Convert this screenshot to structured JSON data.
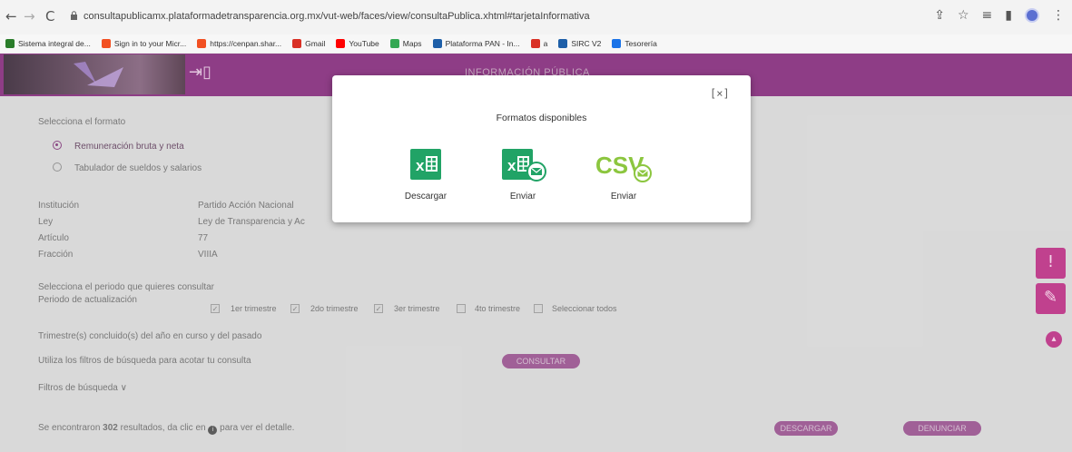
{
  "browser": {
    "url": "consultapublicamx.plataformadetransparencia.org.mx/vut-web/faces/view/consultaPublica.xhtml#tarjetaInformativa",
    "bookmarks": [
      {
        "label": "Sistema integral de...",
        "color": "#2a7d2a"
      },
      {
        "label": "Sign in to your Micr...",
        "color": "#f25022"
      },
      {
        "label": "https://cenpan.shar...",
        "color": "#f25022"
      },
      {
        "label": "Gmail",
        "color": "#d93025"
      },
      {
        "label": "YouTube",
        "color": "#ff0000"
      },
      {
        "label": "Maps",
        "color": "#34a853"
      },
      {
        "label": "Plataforma PAN - In...",
        "color": "#1e5fa8"
      },
      {
        "label": "a",
        "color": "#d93025"
      },
      {
        "label": "SIRC V2",
        "color": "#1e5fa8"
      },
      {
        "label": "Tesorería",
        "color": "#1a73e8"
      }
    ]
  },
  "header": {
    "title": "INFORMACIÓN PÚBLICA"
  },
  "content": {
    "select_format_label": "Selecciona el formato",
    "radio_options": [
      "Remuneración bruta y neta",
      "Tabulador de sueldos y salarios"
    ],
    "fields": {
      "institucion_label": "Institución",
      "institucion_value": "Partido Acción Nacional",
      "ley_label": "Ley",
      "ley_value": "Ley de Transparencia y Ac",
      "articulo_label": "Artículo",
      "articulo_value": "77",
      "fraccion_label": "Fracción",
      "fraccion_value": "VIIIA"
    },
    "period_prompt": "Selecciona el periodo que quieres consultar",
    "period_label": "Periodo de actualización",
    "quarters": [
      "1er trimestre",
      "2do trimestre",
      "3er trimestre",
      "4to trimestre",
      "Seleccionar todos"
    ],
    "quarters_note": "Trimestre(s) concluido(s) del año en curso y del pasado",
    "filters_hint": "Utiliza los filtros de búsqueda para acotar tu consulta",
    "consult_button": "CONSULTAR",
    "filters_toggle": "Filtros de búsqueda",
    "results_prefix": "Se encontraron",
    "results_count": "302",
    "results_suffix_1": "resultados, da clic en",
    "results_suffix_2": "para ver el detalle.",
    "download_button": "DESCARGAR",
    "report_button": "DENUNCIAR"
  },
  "modal": {
    "close_label": "[×]",
    "title": "Formatos disponibles",
    "formats": [
      {
        "label": "Descargar",
        "icon": "excel-icon"
      },
      {
        "label": "Enviar",
        "icon": "excel-email-icon"
      },
      {
        "label": "Enviar",
        "icon": "csv-email-icon",
        "csv_text": "CSV"
      }
    ]
  },
  "colors": {
    "header": "#8e3d86",
    "excel_green": "#21a366",
    "csv_green": "#8cc63f",
    "side_button": "#c0418e"
  }
}
